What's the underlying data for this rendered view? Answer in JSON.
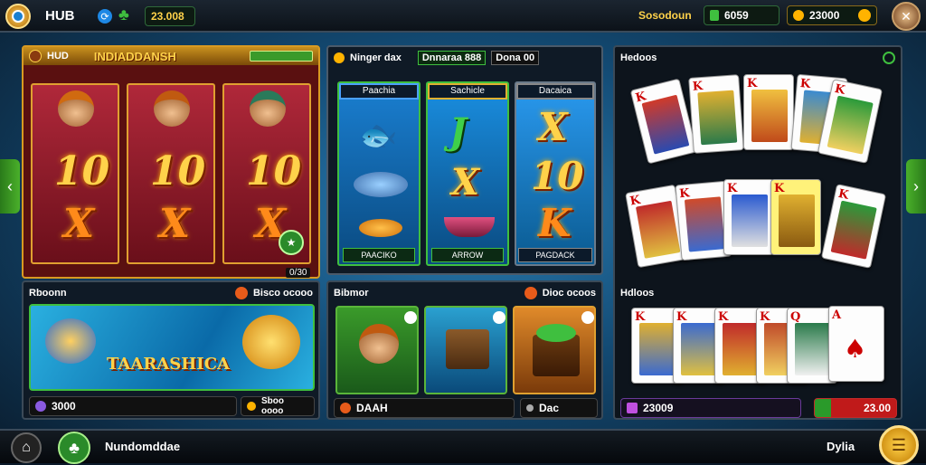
{
  "topbar": {
    "title": "HUB",
    "balance": "23.008",
    "session_label": "Sosodoun",
    "wallet_a": "6059",
    "wallet_b": "23000"
  },
  "left_slot": {
    "tag": "HUD",
    "title": "INDIADDANSH",
    "reels": [
      {
        "top": "10",
        "bottom": "X"
      },
      {
        "top": "10",
        "bottom": "X"
      },
      {
        "top": "10",
        "bottom": "X"
      }
    ],
    "counter": "0/30"
  },
  "mid_slot": {
    "title": "Ninger dax",
    "stat": "Dnnaraa 888",
    "stat2": "Dona 00",
    "reels": [
      {
        "label": "Paachia",
        "footer": "PAACIKO"
      },
      {
        "label": "Sachicle",
        "footer": "ARROW",
        "symbols": [
          "J",
          "X"
        ]
      },
      {
        "label": "Dacaica",
        "footer": "PAGDACK",
        "symbols": [
          "X",
          "10",
          "K"
        ]
      }
    ]
  },
  "cards_panel": {
    "title": "Hedoos",
    "lower_title": "Hdloos",
    "footer_left": "23009",
    "footer_right": "23.00"
  },
  "promo_left": {
    "title": "Rboonn",
    "right": "Bisco ocooo",
    "banner": "TAARASHICA",
    "footer_left": "3000",
    "footer_right": "Sboo oooo"
  },
  "promo_mid": {
    "title": "Bibmor",
    "right": "Dioc ocoos",
    "footer_left": "DAAH",
    "footer_right": "Dac"
  },
  "bottombar": {
    "label": "Nundomddae",
    "right_label": "Dylia"
  },
  "colors": {
    "accent_gold": "#ffd24a",
    "accent_green": "#3fbf3f",
    "panel": "#0f1a26"
  }
}
